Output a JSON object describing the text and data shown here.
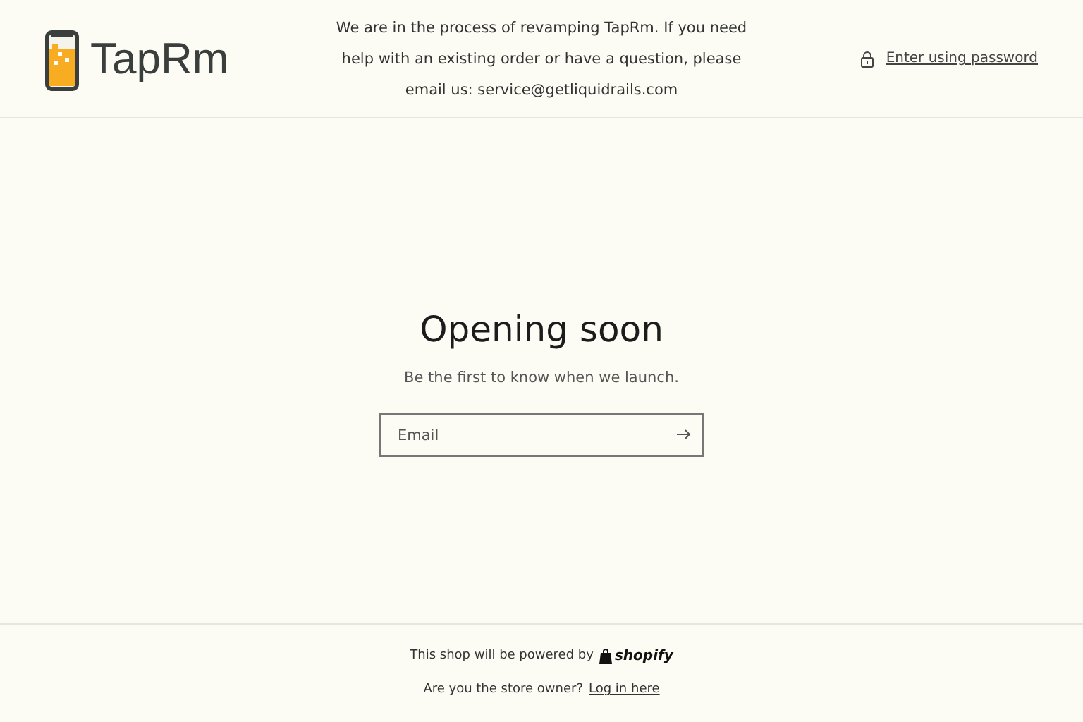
{
  "header": {
    "logo": "TapRm",
    "announcement": "We are in the process of revamping TapRm. If you need help with an existing order or have a question, please email us: service@getliquidrails.com",
    "password_link": "Enter using password"
  },
  "main": {
    "title": "Opening soon",
    "subtitle": "Be the first to know when we launch.",
    "email_field": {
      "placeholder": "Email"
    }
  },
  "footer": {
    "powered_by": "This shop will be powered by",
    "shopify": "shopify",
    "owner_question": "Are you the store owner?",
    "login_link": "Log in here"
  }
}
